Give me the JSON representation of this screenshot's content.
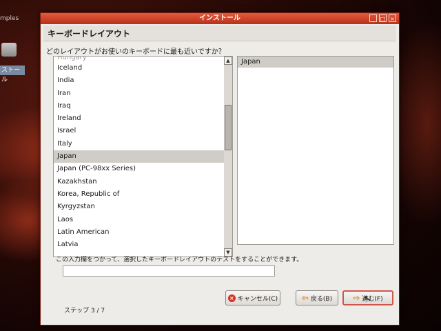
{
  "desktop": {
    "top_text": "mples",
    "icon_label": "ストール"
  },
  "window": {
    "title": "インストール",
    "controls": {
      "minimize": "_",
      "maximize": "□",
      "close": "×"
    }
  },
  "page": {
    "header": "キーボードレイアウト",
    "question": "どのレイアウトがお使いのキーボードに最も近いですか？"
  },
  "layout_list": {
    "items": [
      {
        "label": "Hungary",
        "partial": true
      },
      {
        "label": "Iceland"
      },
      {
        "label": "India"
      },
      {
        "label": "Iran"
      },
      {
        "label": "Iraq"
      },
      {
        "label": "Ireland"
      },
      {
        "label": "Israel"
      },
      {
        "label": "Italy"
      },
      {
        "label": "Japan",
        "selected": true
      },
      {
        "label": "Japan (PC-98xx Series)"
      },
      {
        "label": "Kazakhstan"
      },
      {
        "label": "Korea, Republic of"
      },
      {
        "label": "Kyrgyzstan"
      },
      {
        "label": "Laos"
      },
      {
        "label": "Latin American"
      },
      {
        "label": "Latvia"
      }
    ],
    "scroll_up": "▲",
    "scroll_down": "▼"
  },
  "variant_list": {
    "items": [
      {
        "label": "Japan",
        "selected": true
      }
    ]
  },
  "test_area": {
    "label": "この入力欄をつかって、選択したキーボードレイアウトのテストをすることができます。",
    "value": ""
  },
  "buttons": {
    "cancel": "キャンセル(C)",
    "back": "戻る(B)",
    "next": "進む(F)"
  },
  "icons": {
    "cancel_icon": "×",
    "back_icon": "⇦",
    "next_icon": "⇨"
  },
  "step": "ステップ 3 / 7",
  "colors": {
    "titlebar": "#c8402a",
    "selection": "#d0cdc8",
    "window_bg": "#eeece9"
  }
}
